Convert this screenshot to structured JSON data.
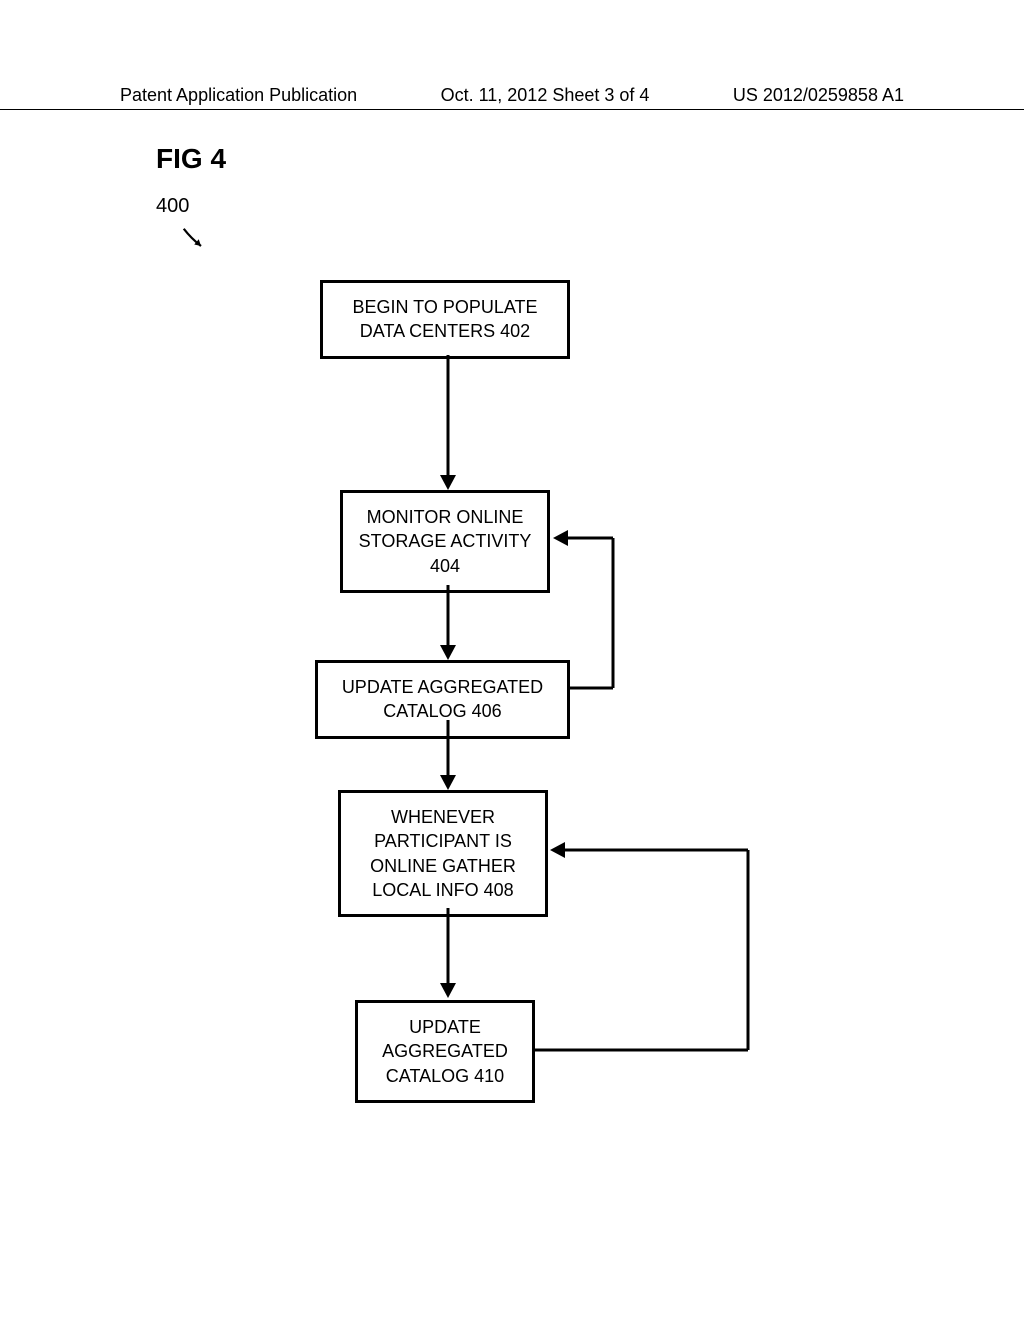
{
  "header": {
    "left": "Patent Application Publication",
    "center": "Oct. 11, 2012  Sheet 3 of 4",
    "right": "US 2012/0259858 A1"
  },
  "figure": {
    "label": "FIG 4",
    "ref_number": "400"
  },
  "chart_data": {
    "type": "flowchart",
    "title": "FIG 4",
    "ref": "400",
    "nodes": [
      {
        "id": "402",
        "text": "BEGIN TO POPULATE DATA CENTERS  402"
      },
      {
        "id": "404",
        "text": "MONITOR ONLINE STORAGE ACTIVITY 404"
      },
      {
        "id": "406",
        "text": "UPDATE AGGREGATED CATALOG  406"
      },
      {
        "id": "408",
        "text": "WHENEVER PARTICIPANT IS ONLINE GATHER LOCAL INFO  408"
      },
      {
        "id": "410",
        "text": "UPDATE AGGREGATED CATALOG  410"
      }
    ],
    "edges": [
      {
        "from": "402",
        "to": "404"
      },
      {
        "from": "404",
        "to": "406"
      },
      {
        "from": "406",
        "to": "404",
        "loop": true
      },
      {
        "from": "406",
        "to": "408"
      },
      {
        "from": "408",
        "to": "410"
      },
      {
        "from": "410",
        "to": "408",
        "loop": true
      }
    ]
  }
}
